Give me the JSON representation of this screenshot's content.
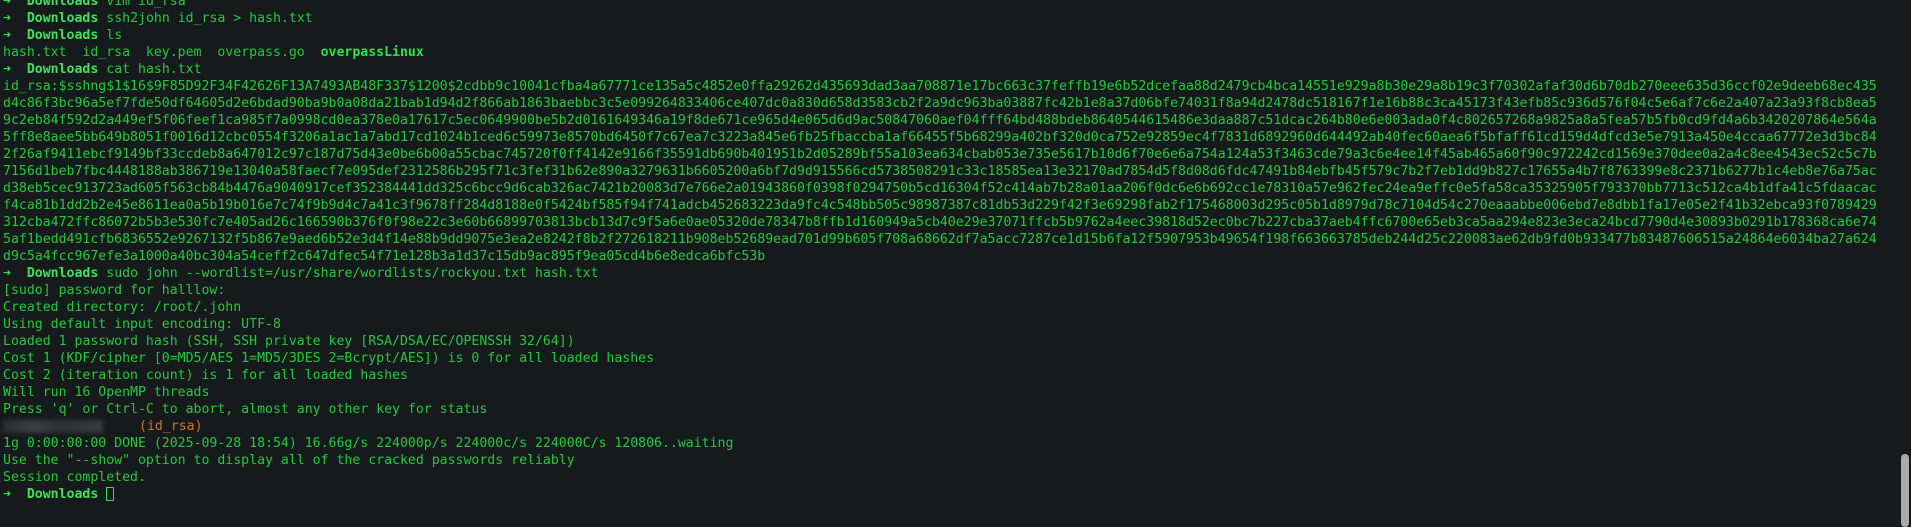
{
  "prompt": {
    "arrow": "➜",
    "cwd": "Downloads"
  },
  "commands": {
    "c1": "vim id_rsa",
    "c2": "ssh2john id_rsa > hash.txt",
    "c3": "ls",
    "c4": "cat hash.txt",
    "c5": "sudo john --wordlist=/usr/share/wordlists/rockyou.txt hash.txt",
    "c6": ""
  },
  "ls_output": {
    "plain": "hash.txt  id_rsa  key.pem  overpass.go  ",
    "executable": "overpassLinux"
  },
  "hash_text": "id_rsa:$sshng$1$16$9F85D92F34F42626F13A7493AB48F337$1200$2cdbb9c10041cfba4a67771ce135a5c4852e0ffa29262d435693dad3aa708871e17bc663c37feffb19e6b52dcefaa88d2479cb4bca14551e929a8b30e29a8b19c3f70302afaf30d6b70db270eee635d36ccf02e9deeb68ec435d4c86f3bc96a5ef7fde50df64605d2e6bdad90ba9b0a08da21bab1d94d2f866ab1863baebbc3c5e099264833406ce407dc0a830d658d3583cb2f2a9dc963ba03887fc42b1e8a37d06bfe74031f8a94d2478dc518167f1e16b88c3ca45173f43efb85c936d576f04c5e6af7c6e2a407a23a93f8cb8ea59c2eb84f592d2a449ef5f06feef1ca985f7a0998cd0ea378e0a17617c5ec0649900be5b2d0161649346a19f8de671ce965d4e065d6d9ac50847060aef04fff64bd488bdeb8640544615486e3daa887c51dcac264b80e6e003ada0f4c802657268a9825a8a5fea57b5fb0cd9fd4a6b3420207864e564a5ff8e8aee5bb649b8051f0016d12cbc0554f3206a1ac1a7abd17cd1024b1ced6c59973e8570bd6450f7c67ea7c3223a845e6fb25fbaccba1af66455f5b68299a402bf320d0ca752e92859ec4f7831d6892960d644492ab40fec60aea6f5bfaff61cd159d4dfcd3e5e7913a450e4ccaa67772e3d3bc842f26af9411ebcf9149bf33ccdeb8a647012c97c187d75d43e0be6b00a55cbac745720f0ff4142e9166f35591db690b401951b2d05289bf55a103ea634cbab053e735e5617b10d6f70e6e6a754a124a53f3463cde79a3c6e4ee14f45ab465a60f90c972242cd1569e370dee0a2a4c8ee4543ec52c5c7b7156d1beb7fbc4448188ab386719e13040a58faecf7e095def2312586b295f71c3fef31b62e890a3279631b6605200a6bf7d9d915566cd5738508291c33c18585ea13e32170ad7854d5f8d08d6fdc47491b84ebfb45f579c7b2f7eb1dd9b827c17655a4b7f8763399e8c2371b6277b1c4eb8e76a75acd38eb5cec913723ad605f563cb84b4476a9040917cef352384441dd325c6bcc9d6cab326ac7421b20083d7e766e2a01943860f0398f0294750b5cd16304f52c414ab7b28a01aa206f0dc6e6b692cc1e78310a57e962fec24ea9effc0e5fa58ca35325905f793370bb7713c512ca4b1dfa41c5fdaacacf4ca81b1dd2b2e45e8611ea0a5b19b016e7c74f9b9d4c7a41c3f9678ff284d8188e0f5424bf585f94f741adcb452683223da9fc4c548bb505c98987387c81db53d229f42f3e69298fab2f175468003d295c05b1d8979d78c7104d54c270eaaabbe006ebd7e8dbb1fa17e05e2f41b32ebca93f0789429312cba472ffc86072b5b3e530fc7e405ad26c166590b376f0f98e22c3e60b66899703813bcb13d7c9f5a6e0ae05320de78347b8ffb1d160949a5cb40e29e37071ffcb5b9762a4eec39818d52ec0bc7b227cba37aeb4ffc6700e65eb3ca5aa294e823e3eca24bcd7790d4e30893b0291b178368ca6e745af1bedd491cfb6836552e9267132f5b867e9aed6b52e3d4f14e88b9dd9075e3ea2e8242f8b2f272618211b908eb52689ead701d99b605f708a68662df7a5acc7287ce1d15b6fa12f5907953b49654f198f663663785deb244d25c220083ae62db9fd0b933477b83487606515a24864e6034ba27a624d9c5a4fcc967efe3a1000a40bc304a54ceff2c647dfec54f71e128b3a1d37c15db9ac895f9ea05cd4b6e8edca6bfc53b",
  "john_output": [
    "[sudo] password for halllow: ",
    "Created directory: /root/.john",
    "Using default input encoding: UTF-8",
    "Loaded 1 password hash (SSH, SSH private key [RSA/DSA/EC/OPENSSH 32/64])",
    "Cost 1 (KDF/cipher [0=MD5/AES 1=MD5/3DES 2=Bcrypt/AES]) is 0 for all loaded hashes",
    "Cost 2 (iteration count) is 1 for all loaded hashes",
    "Will run 16 OpenMP threads",
    "Press 'q' or Ctrl-C to abort, almost any other key for status"
  ],
  "cracked_user": "(id_rsa)",
  "john_done": [
    "1g 0:00:00:00 DONE (2025-09-28 18:54) 16.66g/s 224000p/s 224000c/s 224000C/s 120806..waiting",
    "Use the \"--show\" option to display all of the cracked passwords reliably",
    "Session completed."
  ],
  "colors": {
    "background": "#171a1c",
    "text": "#22c93a",
    "prompt": "#2ee24a",
    "highlight_user": "#c8772a"
  },
  "icons": {
    "cursor": "block-cursor-icon",
    "scrollbar": "scrollbar-thumb"
  }
}
